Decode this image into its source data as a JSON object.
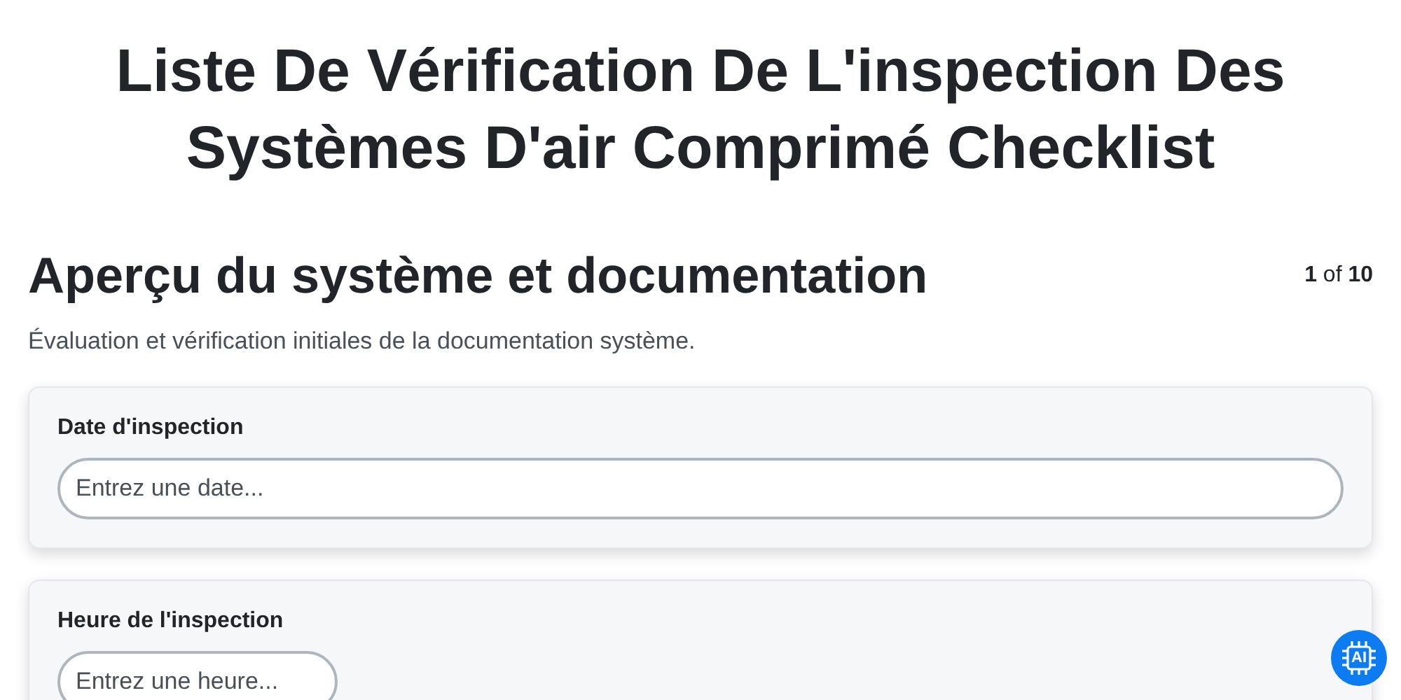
{
  "title": "Liste De Vérification De L'inspection Des Systèmes D'air Comprimé Checklist",
  "section": {
    "heading": "Aperçu du système et documentation",
    "pager": "**1** of **10**",
    "description": "Évaluation et vérification initiales de la documentation système."
  },
  "questions": [
    {
      "label": "Date d'inspection",
      "kind": "date",
      "placeholder": "Entrez une date..."
    },
    {
      "label": "Heure de l'inspection",
      "kind": "time",
      "placeholder": "Entrez une heure..."
    }
  ],
  "ai_button": {
    "label": "AI"
  }
}
